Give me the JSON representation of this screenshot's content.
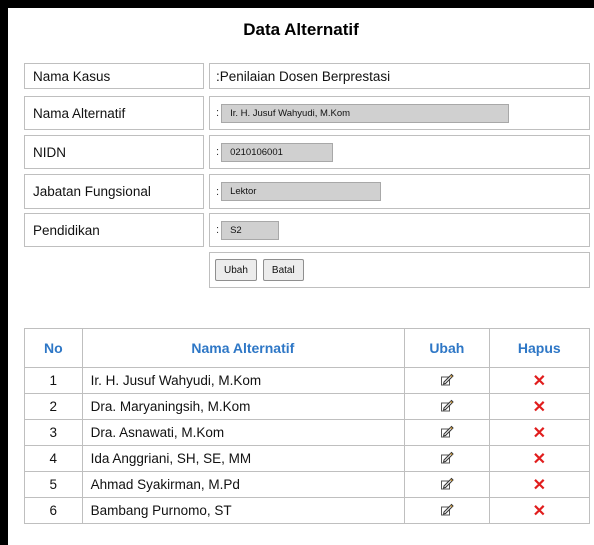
{
  "title": "Data Alternatif",
  "form": {
    "nama_kasus_label": "Nama Kasus",
    "nama_kasus_value": ":Penilaian Dosen Berprestasi",
    "nama_alternatif_label": "Nama Alternatif",
    "nama_alternatif_value": "Ir. H. Jusuf Wahyudi, M.Kom",
    "nidn_label": "NIDN",
    "nidn_value": "0210106001",
    "jabatan_label": "Jabatan Fungsional",
    "jabatan_value": "Lektor",
    "pendidikan_label": "Pendidikan",
    "pendidikan_value": "S2",
    "colon": ":",
    "ubah_button": "Ubah",
    "batal_button": "Batal"
  },
  "table": {
    "headers": {
      "no": "No",
      "nama": "Nama Alternatif",
      "ubah": "Ubah",
      "hapus": "Hapus"
    },
    "rows": [
      {
        "no": "1",
        "nama": "Ir. H. Jusuf Wahyudi, M.Kom"
      },
      {
        "no": "2",
        "nama": "Dra. Maryaningsih, M.Kom"
      },
      {
        "no": "3",
        "nama": "Dra. Asnawati, M.Kom"
      },
      {
        "no": "4",
        "nama": "Ida Anggriani, SH, SE, MM"
      },
      {
        "no": "5",
        "nama": "Ahmad Syakirman, M.Pd"
      },
      {
        "no": "6",
        "nama": "Bambang Purnomo, ST"
      }
    ],
    "edit_icon": "edit-icon",
    "delete_icon": "delete-x-icon",
    "delete_glyph": "✕"
  },
  "colors": {
    "header_text": "#2e77c6",
    "delete": "#e11d1d",
    "field_bg": "#d0d0d0"
  }
}
